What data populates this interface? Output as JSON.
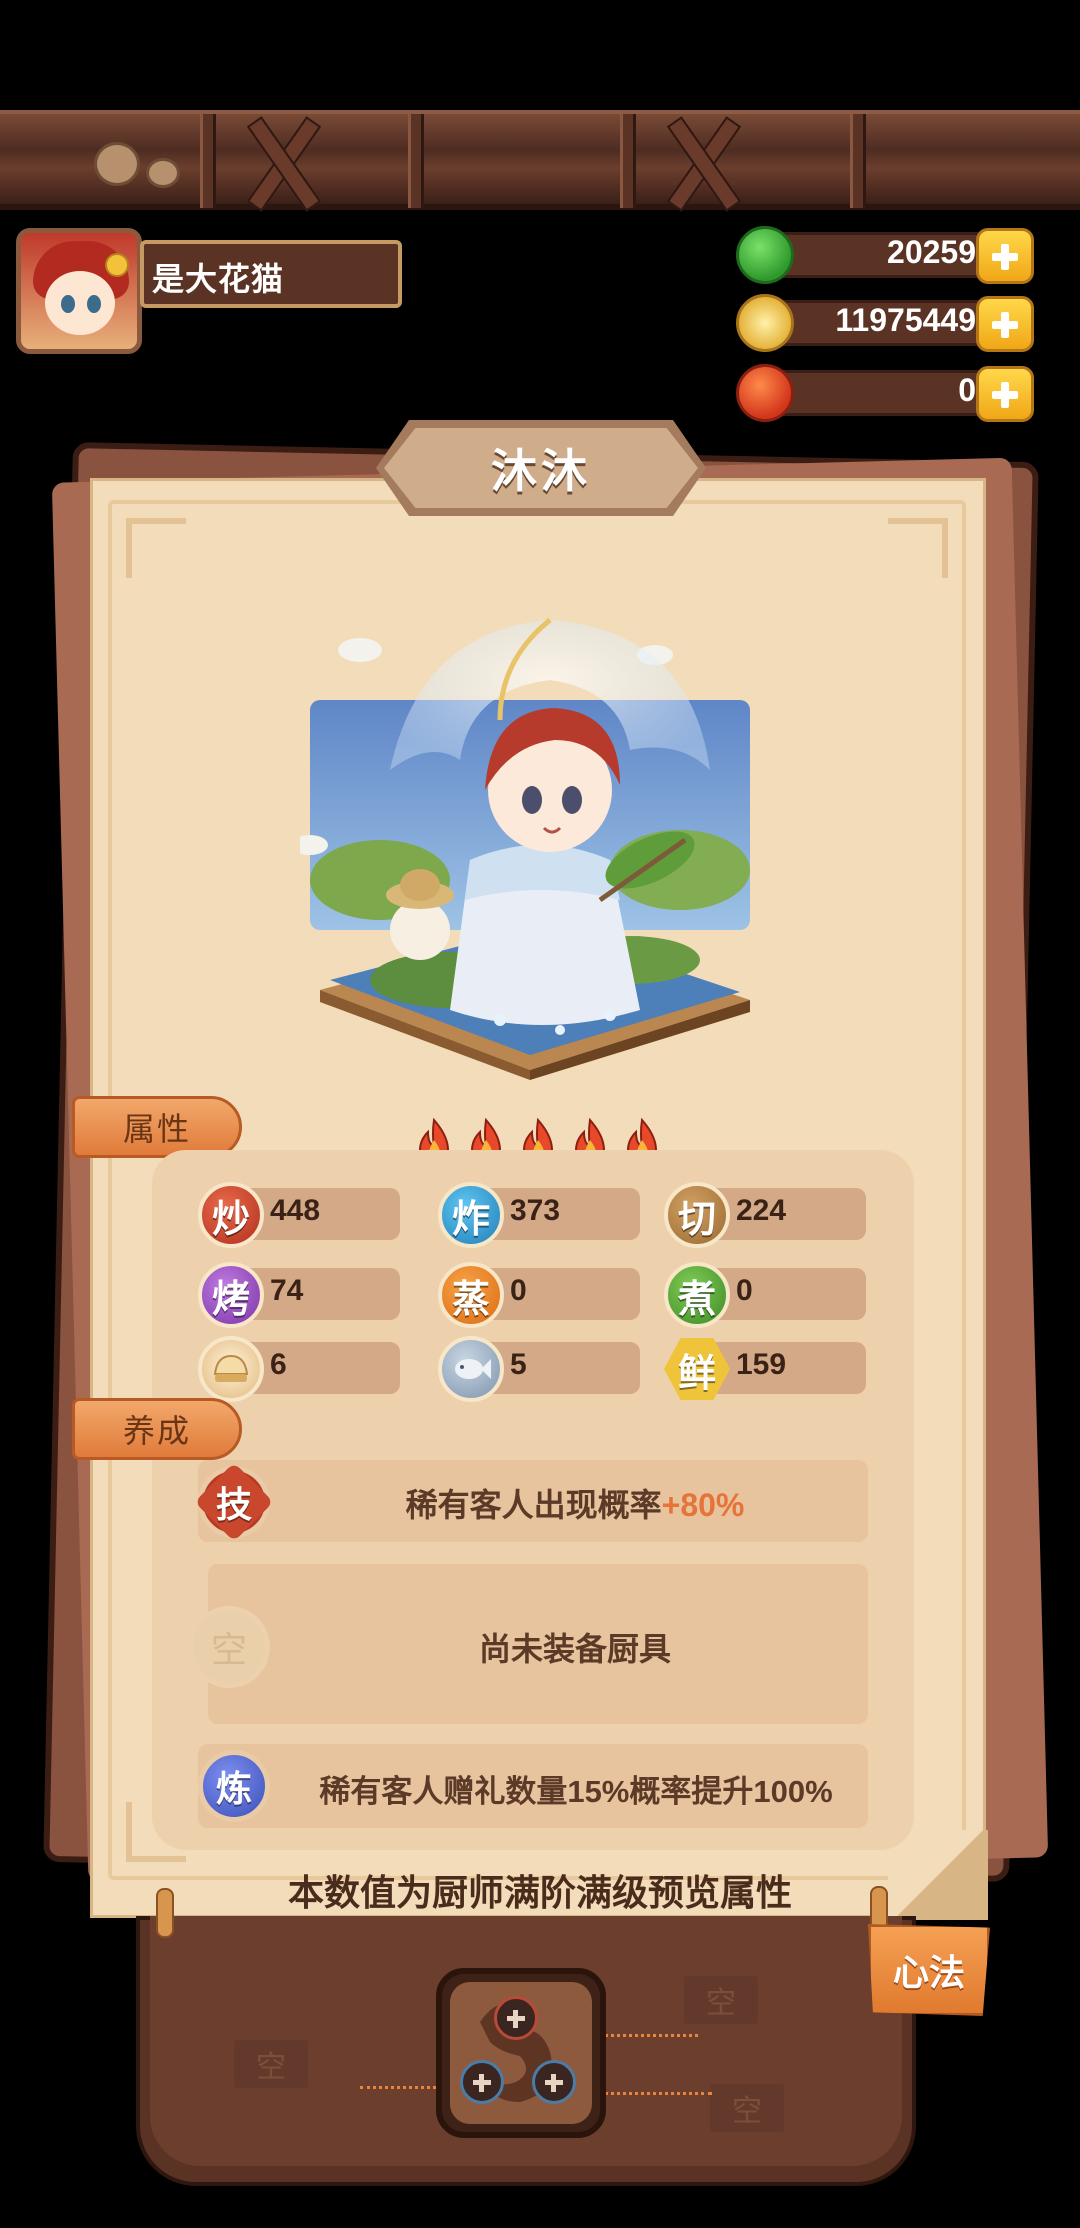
{
  "player": {
    "name": "是大花猫"
  },
  "currencies": [
    {
      "value": "20259",
      "icon": "green-jade-icon"
    },
    {
      "value": "11975449",
      "icon": "gold-coin-icon"
    },
    {
      "value": "0",
      "icon": "red-fruit-icon"
    }
  ],
  "chef": {
    "name": "沐沐",
    "stars": 5
  },
  "sections": {
    "attributes": "属性",
    "training": "养成"
  },
  "stats": [
    {
      "label": "炒",
      "value": "448",
      "color": "#b22f1f"
    },
    {
      "label": "炸",
      "value": "373",
      "color": "#1f7fb8"
    },
    {
      "label": "切",
      "value": "224",
      "color": "#9a6a31"
    },
    {
      "label": "烤",
      "value": "74",
      "color": "#7b35a8"
    },
    {
      "label": "蒸",
      "value": "0",
      "color": "#db6c14"
    },
    {
      "label": "煮",
      "value": "0",
      "color": "#3e8a25"
    },
    {
      "label": "",
      "value": "6",
      "icon": "bun-icon"
    },
    {
      "label": "",
      "value": "5",
      "icon": "fish-icon"
    },
    {
      "label": "鲜",
      "value": "159",
      "color": "#f0c43a"
    }
  ],
  "training": {
    "skill": {
      "icon_label": "技",
      "text": "稀有客人出现概率",
      "highlight": "+80%"
    },
    "equipment": {
      "icon_label": "空",
      "text": "尚未装备厨具"
    },
    "refine": {
      "icon_label": "炼",
      "text": "稀有客人赠礼数量15%概率提升100%"
    }
  },
  "footer_note": "本数值为厨师满阶满级预览属性",
  "bottom": {
    "xinfa_label": "心法",
    "empty_slot_label": "空"
  }
}
